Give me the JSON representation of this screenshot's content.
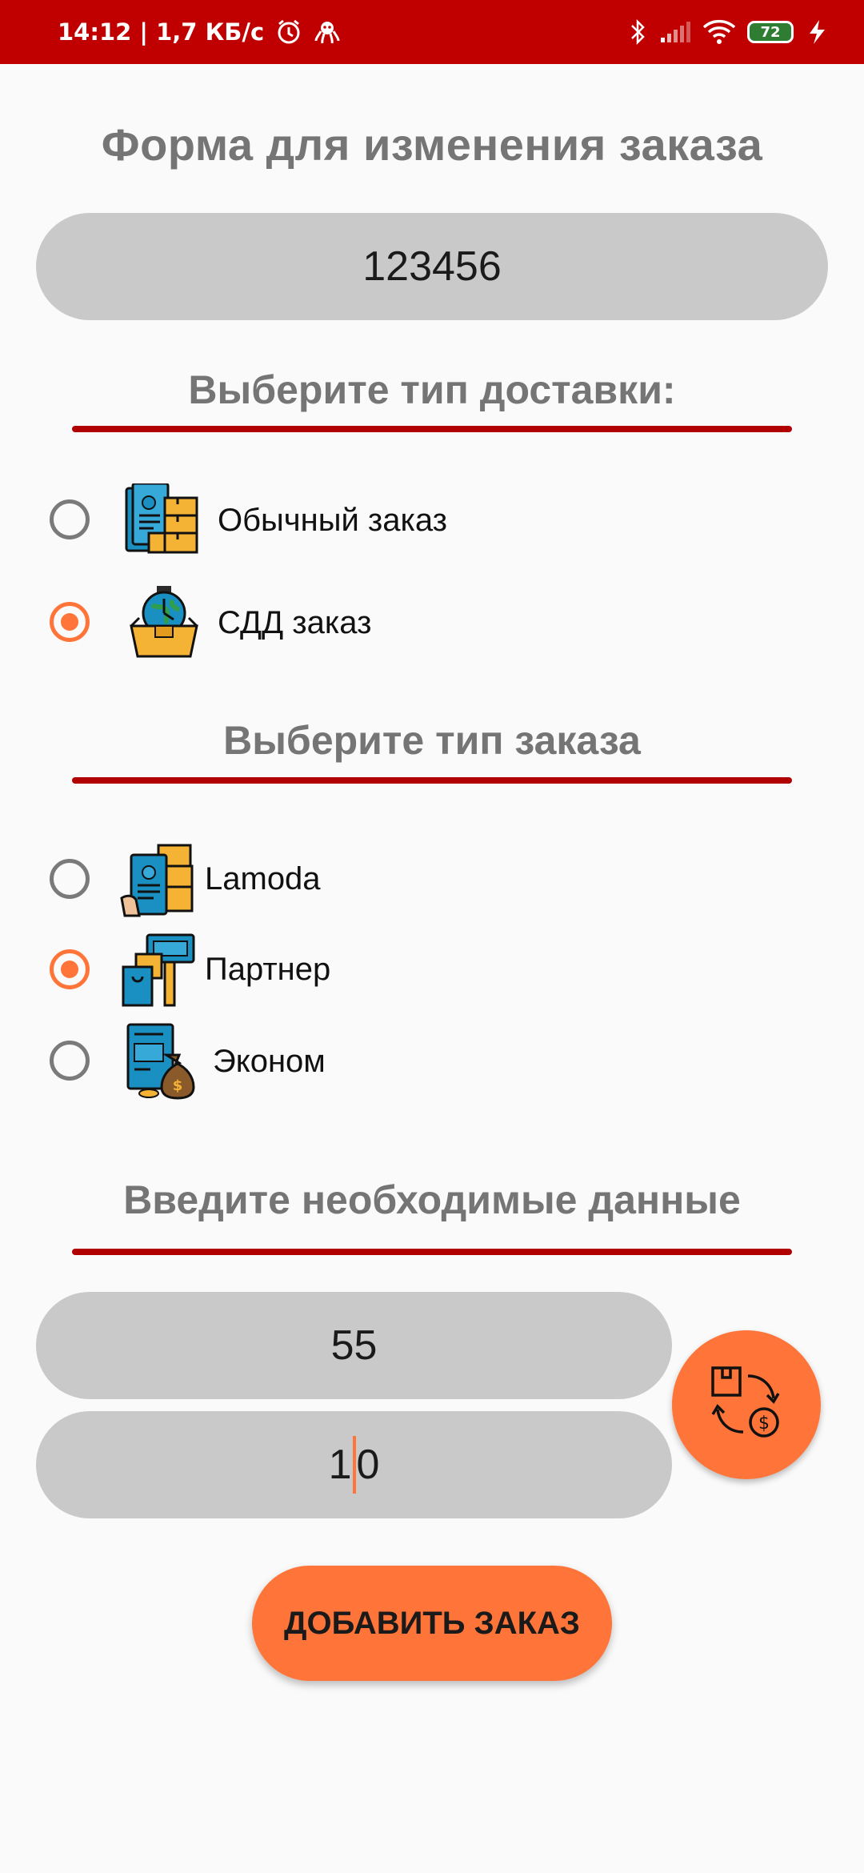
{
  "status_bar": {
    "time_speed": "14:12 | 1,7 КБ/с",
    "battery": "72",
    "icons": [
      "alarm-icon",
      "octopus-icon",
      "bluetooth-icon",
      "signal-icon",
      "wifi-icon",
      "battery-icon",
      "charging-icon"
    ]
  },
  "form": {
    "title": "Форма для изменения заказа",
    "order_number": "123456"
  },
  "delivery": {
    "title": "Выберите тип доставки:",
    "options": [
      {
        "label": "Обычный заказ",
        "checked": false,
        "icon": "documents-boxes-icon"
      },
      {
        "label": "СДД заказ",
        "checked": true,
        "icon": "globe-box-icon"
      }
    ]
  },
  "order_type": {
    "title": "Выберите тип заказа",
    "options": [
      {
        "label": "Lamoda",
        "checked": false,
        "icon": "hand-boxes-icon"
      },
      {
        "label": "Партнер",
        "checked": true,
        "icon": "boxes-sign-icon"
      },
      {
        "label": "Эконом",
        "checked": false,
        "icon": "document-money-bag-icon"
      }
    ]
  },
  "data_entry": {
    "title": "Введите необходимые данные",
    "field1_value": "55",
    "field2_value_before_caret": "1",
    "field2_value_after_caret": "0"
  },
  "actions": {
    "fab_icon": "box-exchange-money-icon",
    "add_button": "ДОБАВИТЬ ЗАКАЗ"
  },
  "colors": {
    "status_bar": "#c00000",
    "accent": "#ff7438",
    "divider": "#b00000",
    "field_bg": "#c9c9c9"
  }
}
